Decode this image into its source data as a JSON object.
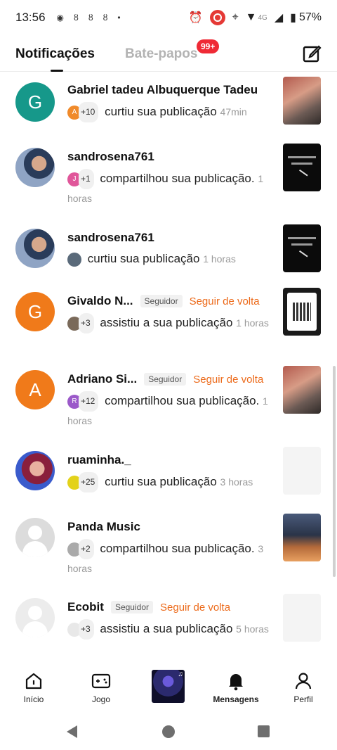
{
  "status_bar": {
    "time": "13:56",
    "network": "4G",
    "battery": "57%"
  },
  "header": {
    "tab_active": "Notificações",
    "tab_inactive": "Bate-papos",
    "badge": "99+"
  },
  "notifications": [
    {
      "avatar_letter": "G",
      "name": "Gabriel tadeu Albuquerque Tadeu",
      "mini_letter": "A",
      "count": "+10",
      "text": "curtiu sua publicação",
      "time": "47min",
      "thumb": "red"
    },
    {
      "avatar_letter": "",
      "name": "sandrosena761",
      "mini_letter": "J",
      "count": "+1",
      "text": "compartilhou sua publicação.",
      "time": "1 horas",
      "thumb": "black"
    },
    {
      "avatar_letter": "",
      "name": "sandrosena761",
      "mini_letter": "",
      "count": "",
      "text": "curtiu sua publicação",
      "time": "1 horas",
      "thumb": "black"
    },
    {
      "avatar_letter": "G",
      "name": "Givaldo N...",
      "tag": "Seguidor",
      "follow_back": "Seguir de volta",
      "mini_letter": "",
      "count": "+3",
      "text": "assistiu a sua publicação",
      "time": "1 horas",
      "thumb": "qr"
    },
    {
      "avatar_letter": "A",
      "name": "Adriano Si...",
      "tag": "Seguidor",
      "follow_back": "Seguir de volta",
      "mini_letter": "R",
      "count": "+12",
      "text": "compartilhou sua publicação.",
      "time": "1 horas",
      "thumb": "red"
    },
    {
      "avatar_letter": "",
      "name": "ruaminha._",
      "mini_letter": "",
      "count": "+25",
      "text": "curtiu sua publicação",
      "time": "3 horas",
      "thumb": "blank"
    },
    {
      "avatar_letter": "",
      "name": "Panda Music",
      "mini_letter": "",
      "count": "+2",
      "text": "compartilhou sua publicação.",
      "time": "3 horas",
      "thumb": "moto"
    },
    {
      "avatar_letter": "",
      "name": "Ecobit",
      "tag": "Seguidor",
      "follow_back": "Seguir de volta",
      "mini_letter": "",
      "count": "+3",
      "text": "assistiu a sua publicação",
      "time": "5 horas",
      "thumb": "blank"
    }
  ],
  "bottom_nav": {
    "home": "Início",
    "game": "Jogo",
    "messages": "Mensagens",
    "profile": "Perfil"
  }
}
